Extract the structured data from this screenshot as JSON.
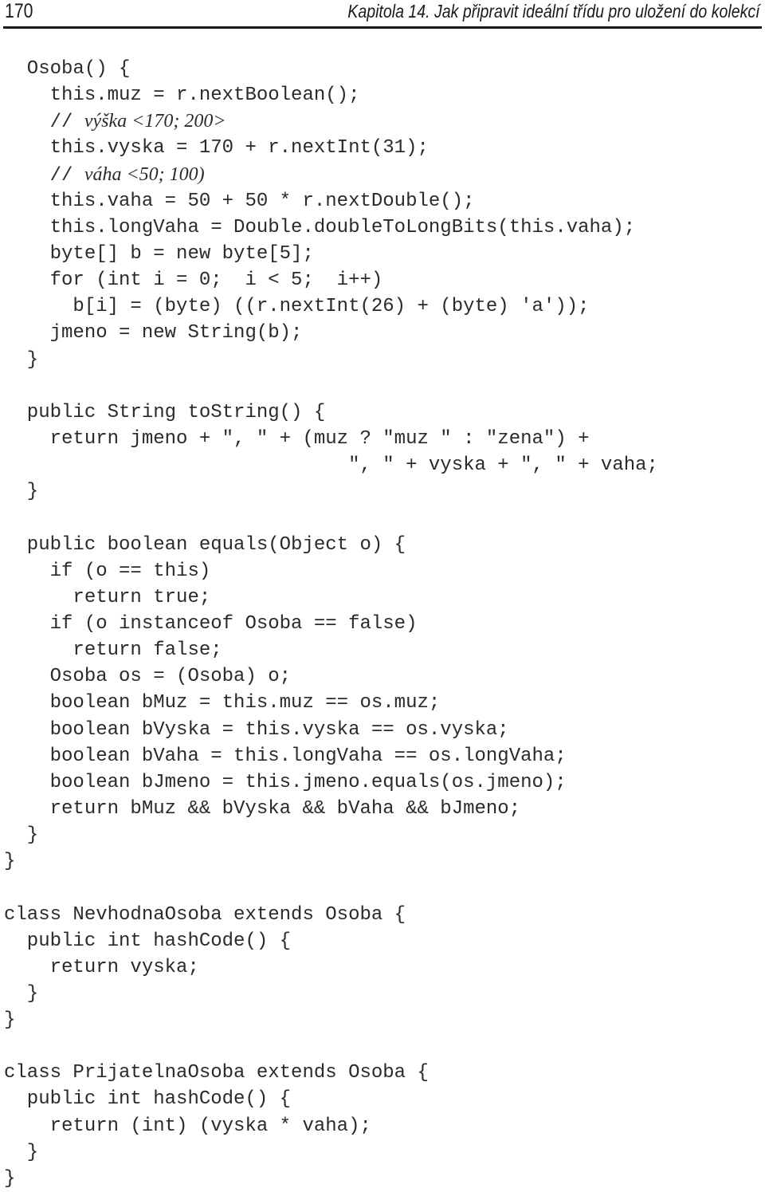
{
  "header": {
    "page_number": "170",
    "chapter_title": "Kapitola 14. Jak připravit ideální třídu pro uložení do kolekcí"
  },
  "code_lines": [
    {
      "indent": 1,
      "text": "Osoba() {"
    },
    {
      "indent": 2,
      "text": "this.muz = r.nextBoolean();"
    },
    {
      "indent": 2,
      "comment": true,
      "prefix": "// ",
      "text": "výška <170; 200>"
    },
    {
      "indent": 2,
      "text": "this.vyska = 170 + r.nextInt(31);"
    },
    {
      "indent": 2,
      "comment": true,
      "prefix": "// ",
      "text": "váha <50; 100)"
    },
    {
      "indent": 2,
      "text": "this.vaha = 50 + 50 * r.nextDouble();"
    },
    {
      "indent": 2,
      "text": "this.longVaha = Double.doubleToLongBits(this.vaha);"
    },
    {
      "indent": 2,
      "text": "byte[] b = new byte[5];"
    },
    {
      "indent": 2,
      "text": "for (int i = 0;  i < 5;  i++)"
    },
    {
      "indent": 3,
      "text": "b[i] = (byte) ((r.nextInt(26) + (byte) 'a'));"
    },
    {
      "indent": 2,
      "text": "jmeno = new String(b);"
    },
    {
      "indent": 1,
      "text": "}"
    },
    {
      "indent": 0,
      "text": ""
    },
    {
      "indent": 1,
      "text": "public String toString() {"
    },
    {
      "indent": 2,
      "text": "return jmeno + \", \" + (muz ? \"muz \" : \"zena\") +"
    },
    {
      "indent": 15,
      "text": "\", \" + vyska + \", \" + vaha;"
    },
    {
      "indent": 1,
      "text": "}"
    },
    {
      "indent": 0,
      "text": ""
    },
    {
      "indent": 1,
      "text": "public boolean equals(Object o) {"
    },
    {
      "indent": 2,
      "text": "if (o == this)"
    },
    {
      "indent": 3,
      "text": "return true;"
    },
    {
      "indent": 2,
      "text": "if (o instanceof Osoba == false)"
    },
    {
      "indent": 3,
      "text": "return false;"
    },
    {
      "indent": 2,
      "text": "Osoba os = (Osoba) o;"
    },
    {
      "indent": 2,
      "text": "boolean bMuz = this.muz == os.muz;"
    },
    {
      "indent": 2,
      "text": "boolean bVyska = this.vyska == os.vyska;"
    },
    {
      "indent": 2,
      "text": "boolean bVaha = this.longVaha == os.longVaha;"
    },
    {
      "indent": 2,
      "text": "boolean bJmeno = this.jmeno.equals(os.jmeno);"
    },
    {
      "indent": 2,
      "text": "return bMuz && bVyska && bVaha && bJmeno;"
    },
    {
      "indent": 1,
      "text": "}"
    },
    {
      "indent": 0,
      "text": "}"
    },
    {
      "indent": 0,
      "text": ""
    },
    {
      "indent": 0,
      "text": "class NevhodnaOsoba extends Osoba {"
    },
    {
      "indent": 1,
      "text": "public int hashCode() {"
    },
    {
      "indent": 2,
      "text": "return vyska;"
    },
    {
      "indent": 1,
      "text": "}"
    },
    {
      "indent": 0,
      "text": "}"
    },
    {
      "indent": 0,
      "text": ""
    },
    {
      "indent": 0,
      "text": "class PrijatelnaOsoba extends Osoba {"
    },
    {
      "indent": 1,
      "text": "public int hashCode() {"
    },
    {
      "indent": 2,
      "text": "return (int) (vyska * vaha);"
    },
    {
      "indent": 1,
      "text": "}"
    },
    {
      "indent": 0,
      "text": "}"
    }
  ]
}
